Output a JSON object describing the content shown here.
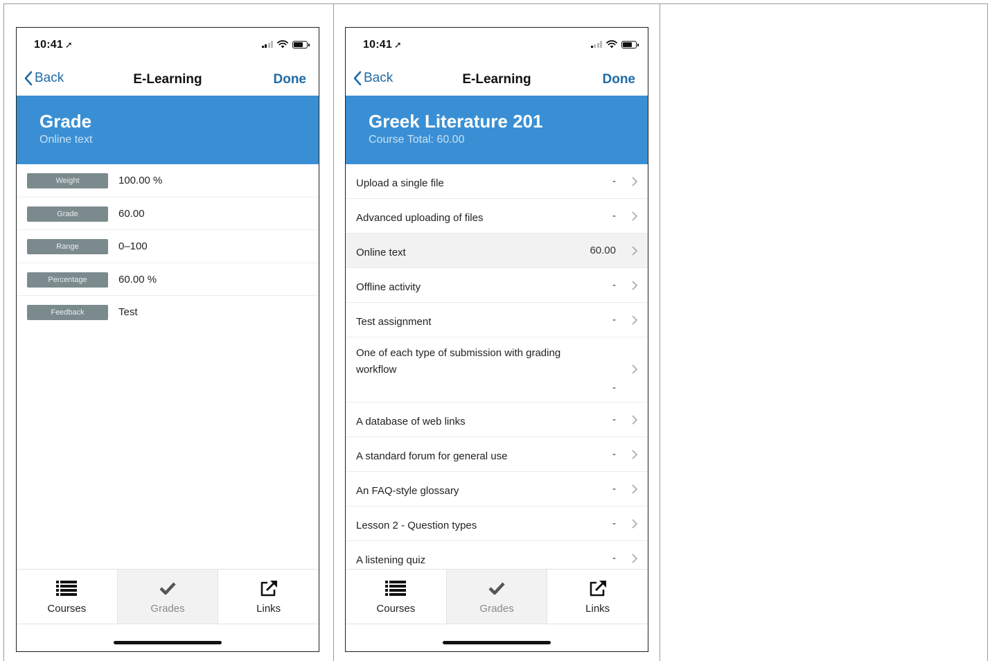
{
  "colors": {
    "accent": "#1d6aa6",
    "banner": "#3a8fd4",
    "pill": "#7b8a8d"
  },
  "phones": [
    {
      "status": {
        "time": "10:41"
      },
      "nav": {
        "back": "Back",
        "title": "E-Learning",
        "done": "Done"
      },
      "banner": {
        "title": "Grade",
        "subtitle": "Online text"
      },
      "grade_rows": [
        {
          "label": "Weight",
          "value": "100.00 %"
        },
        {
          "label": "Grade",
          "value": "60.00"
        },
        {
          "label": "Range",
          "value": "0–100"
        },
        {
          "label": "Percentage",
          "value": "60.00 %"
        },
        {
          "label": "Feedback",
          "value": "Test"
        }
      ],
      "tabs": [
        {
          "label": "Courses",
          "icon": "list-icon"
        },
        {
          "label": "Grades",
          "icon": "checkmark-icon"
        },
        {
          "label": "Links",
          "icon": "external-link-icon"
        }
      ]
    },
    {
      "status": {
        "time": "10:41"
      },
      "nav": {
        "back": "Back",
        "title": "E-Learning",
        "done": "Done"
      },
      "banner": {
        "title": "Greek Literature 201",
        "subtitle": "Course Total: 60.00"
      },
      "items": [
        {
          "name": "Upload a single file",
          "score": "-"
        },
        {
          "name": "Advanced uploading of files",
          "score": "-"
        },
        {
          "name": "Online text",
          "score": "60.00"
        },
        {
          "name": "Offline activity",
          "score": "-"
        },
        {
          "name": "Test assignment",
          "score": "-"
        },
        {
          "name": "One of each type of submission with grading workflow",
          "score": "-"
        },
        {
          "name": "A database of web links",
          "score": "-"
        },
        {
          "name": "A standard forum for general use",
          "score": "-"
        },
        {
          "name": "An FAQ-style glossary",
          "score": "-"
        },
        {
          "name": "Lesson 2 - Question types",
          "score": "-"
        },
        {
          "name": "A listening quiz",
          "score": "-"
        }
      ],
      "tabs": [
        {
          "label": "Courses",
          "icon": "list-icon"
        },
        {
          "label": "Grades",
          "icon": "checkmark-icon"
        },
        {
          "label": "Links",
          "icon": "external-link-icon"
        }
      ]
    }
  ]
}
